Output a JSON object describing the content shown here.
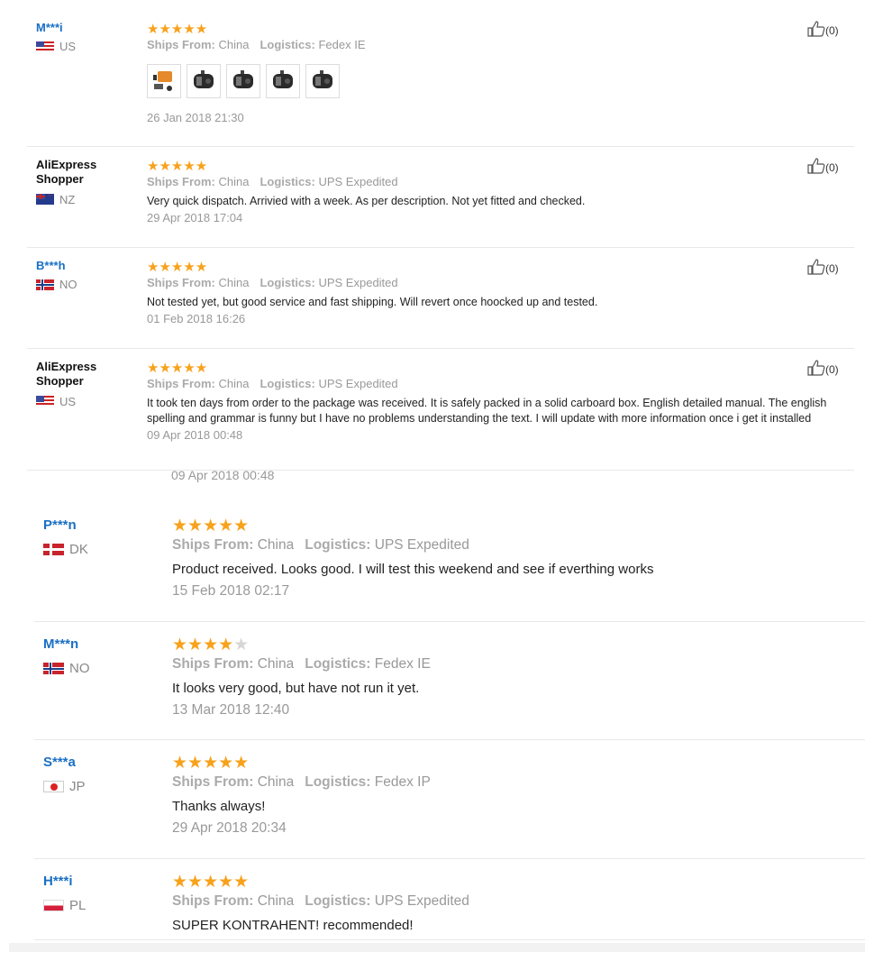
{
  "labels": {
    "ships_from": "Ships From:",
    "logistics": "Logistics:"
  },
  "colors": {
    "star": "#f7a21b",
    "masked_name": "#1a6fc4",
    "muted": "#999999"
  },
  "top_reviews": [
    {
      "user": "M***i",
      "country": "US",
      "flag": "us",
      "stars": 5,
      "ships_from": "China",
      "logistics": "Fedex IE",
      "text": "",
      "date": "26 Jan 2018 21:30",
      "helpful": "(0)",
      "photos": [
        "heater-kit-photo",
        "heater-unit-photo",
        "heater-unit-photo",
        "heater-unit-photo",
        "heater-unit-photo"
      ]
    },
    {
      "user": "AliExpress Shopper",
      "country": "NZ",
      "flag": "nz",
      "stars": 5,
      "ships_from": "China",
      "logistics": "UPS Expedited",
      "text": "Very quick dispatch. Arrivied with a week. As per description. Not yet fitted and checked.",
      "date": "29 Apr 2018 17:04",
      "helpful": "(0)"
    },
    {
      "user": "B***h",
      "country": "NO",
      "flag": "no",
      "stars": 5,
      "ships_from": "China",
      "logistics": "UPS Expedited",
      "text": "Not tested yet, but good service and fast shipping. Will revert once hoocked up and tested.",
      "date": "01 Feb 2018 16:26",
      "helpful": "(0)"
    },
    {
      "user": "AliExpress Shopper",
      "country": "US",
      "flag": "us",
      "stars": 5,
      "ships_from": "China",
      "logistics": "UPS Expedited",
      "text": "It took ten days from order to the package was received. It is safely packed in a solid carboard box. English detailed manual. The english spelling and grammar is funny but I have no problems understanding the text. I will update with more information once i get it installed",
      "date": "09 Apr 2018 00:48",
      "helpful": "(0)"
    }
  ],
  "cut_date": "09 Apr 2018 00:48",
  "bottom_reviews": [
    {
      "user": "P***n",
      "country": "DK",
      "flag": "dk",
      "stars": 5,
      "ships_from": "China",
      "logistics": "UPS Expedited",
      "text": "Product received. Looks good. I will test this weekend and see if everthing works",
      "date": "15 Feb 2018 02:17"
    },
    {
      "user": "M***n",
      "country": "NO",
      "flag": "no",
      "stars": 4,
      "ships_from": "China",
      "logistics": "Fedex IE",
      "text": "It looks very good, but have not run it yet.",
      "date": "13 Mar 2018 12:40"
    },
    {
      "user": "S***a",
      "country": "JP",
      "flag": "jp",
      "stars": 5,
      "ships_from": "China",
      "logistics": "Fedex IP",
      "text": "Thanks always!",
      "date": "29 Apr 2018 20:34"
    },
    {
      "user": "H***i",
      "country": "PL",
      "flag": "pl",
      "stars": 5,
      "ships_from": "China",
      "logistics": "UPS Expedited",
      "text": "SUPER KONTRAHENT! recommended!",
      "date": ""
    }
  ]
}
